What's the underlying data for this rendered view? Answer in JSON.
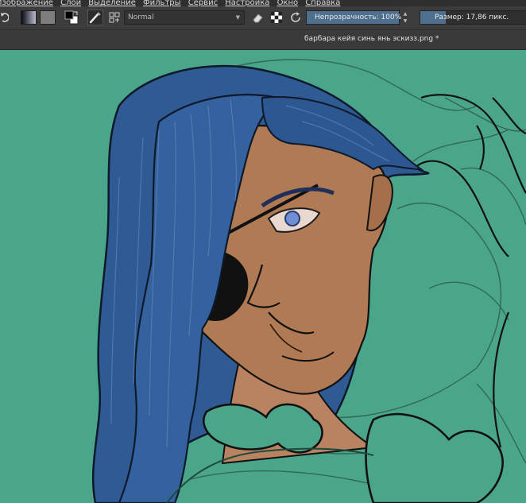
{
  "menubar": {
    "items": [
      {
        "label": "Изображение"
      },
      {
        "label": "Слои"
      },
      {
        "label": "Выделение"
      },
      {
        "label": "Фильтры"
      },
      {
        "label": "Сервис"
      },
      {
        "label": "Настройка"
      },
      {
        "label": "Окно"
      },
      {
        "label": "Справка"
      }
    ]
  },
  "toolbar": {
    "blend_mode": "Normal",
    "opacity_label": "Непрозрачность: 100%",
    "opacity_value": 1.0,
    "size_label": "Размер: 17,86 пикс.",
    "icons": [
      "rotate-icon",
      "gradient-swatch",
      "pattern-swatch",
      "fg-bg-color-icon",
      "brush-preset-icon",
      "brush-settings-icon",
      "eraser-icon",
      "alpha-lock-icon",
      "reload-icon"
    ]
  },
  "document": {
    "tab_title": "барбара кейя синь янь эскизз.png *"
  },
  "colors": {
    "canvas_bg": "#4aa58a",
    "accent": "#4f6f8f",
    "hair": "#2f5a93",
    "skin": "#b07a55"
  }
}
